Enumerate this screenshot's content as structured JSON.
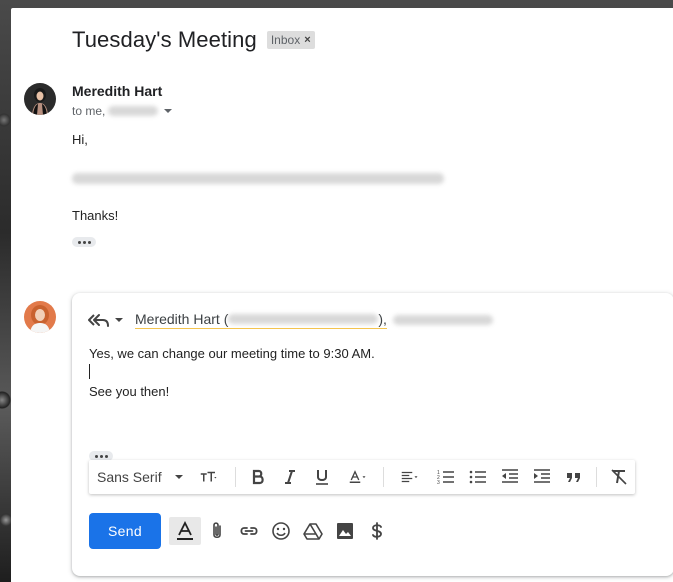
{
  "thread": {
    "subject": "Tuesday's Meeting",
    "label": "Inbox",
    "label_remove": "×"
  },
  "message": {
    "sender_name": "Meredith Hart",
    "to_prefix": "to me,",
    "greeting": "Hi,",
    "signoff": "Thanks!"
  },
  "reply": {
    "recipient_name": "Meredith Hart (",
    "recipient_sep": "),",
    "lines": [
      "Yes, we can change our meeting time to 9:30 AM.",
      "See you then!"
    ]
  },
  "format_toolbar": {
    "font": "Sans Serif",
    "icons": [
      "text-size-icon",
      "bold-icon",
      "italic-icon",
      "underline-icon",
      "text-color-icon",
      "align-icon",
      "numbered-list-icon",
      "bulleted-list-icon",
      "indent-less-icon",
      "indent-more-icon",
      "quote-icon",
      "remove-formatting-icon"
    ]
  },
  "actions": {
    "send_label": "Send",
    "icons": [
      "formatting-options-icon",
      "attach-icon",
      "link-icon",
      "emoji-icon",
      "drive-icon",
      "photo-icon",
      "money-icon"
    ]
  },
  "colors": {
    "send_bg": "#1a73e8",
    "recipient_underline": "#f4c44e"
  }
}
